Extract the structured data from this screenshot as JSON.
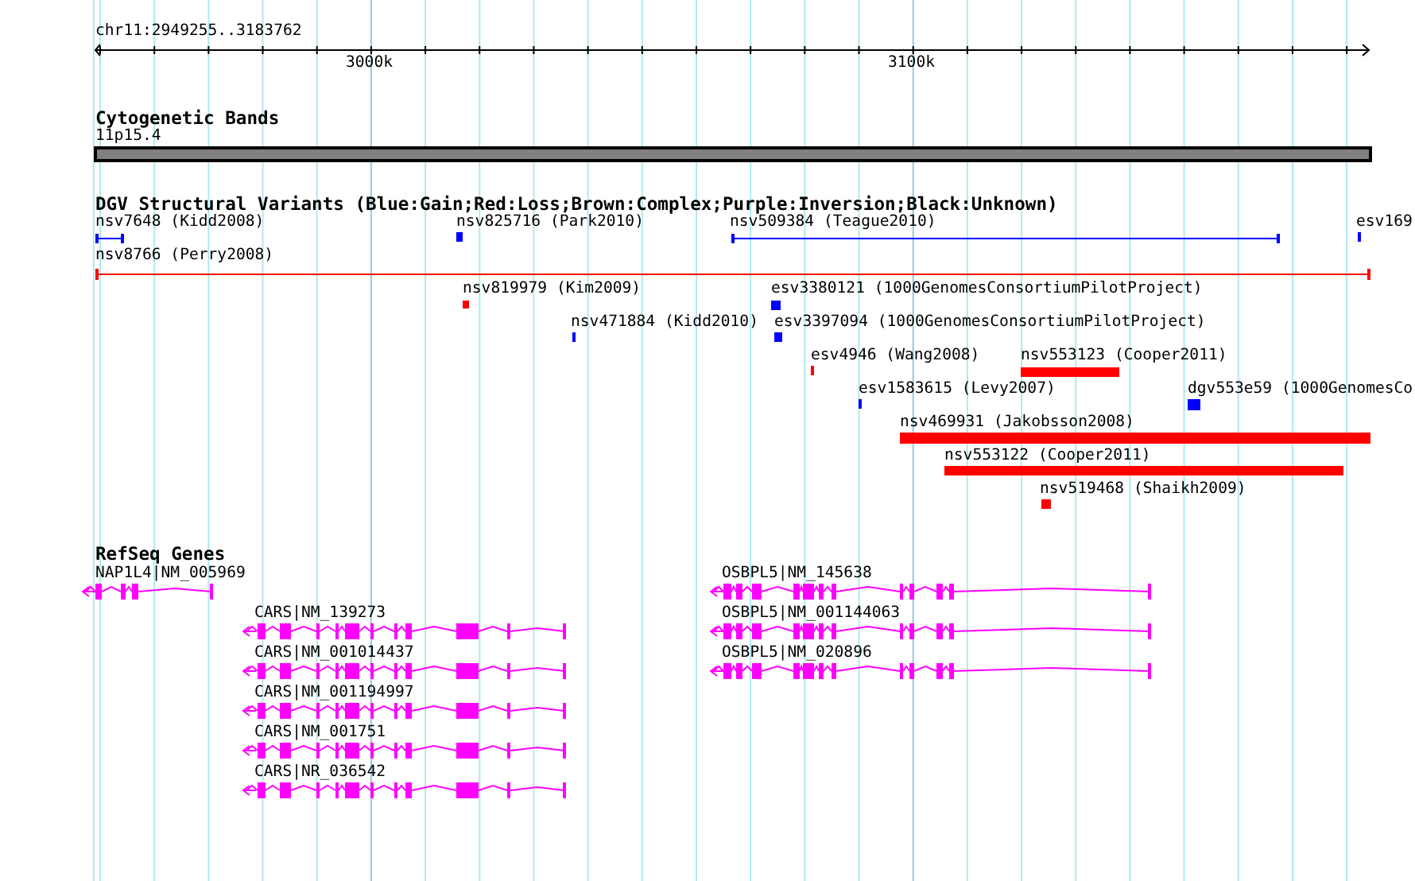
{
  "ruler": {
    "region": "chr11:2949255..3183762",
    "ticks": [
      "3000k",
      "3100k"
    ]
  },
  "tracks": [
    {
      "kind": "cytoband",
      "title": "Cytogenetic Bands",
      "features": [
        {
          "label": "11p15.4"
        }
      ]
    },
    {
      "kind": "variants",
      "title": "DGV Structural Variants (Blue:Gain;Red:Loss;Brown:Complex;Purple:Inversion;Black:Unknown)",
      "features": [
        {
          "label": "nsv7648 (Kidd2008)",
          "color": "#0000ff"
        },
        {
          "label": "nsv825716 (Park2010)",
          "color": "#0000ff"
        },
        {
          "label": "nsv509384 (Teague2010)",
          "color": "#0000ff"
        },
        {
          "label": "esv169",
          "color": "#0000ff"
        },
        {
          "label": "nsv8766 (Perry2008)",
          "color": "#ff0000"
        },
        {
          "label": "nsv819979 (Kim2009)",
          "color": "#ff0000"
        },
        {
          "label": "esv3380121 (1000GenomesConsortiumPilotProject)",
          "color": "#0000ff"
        },
        {
          "label": "nsv471884 (Kidd2010)",
          "color": "#0000ff"
        },
        {
          "label": "esv3397094 (1000GenomesConsortiumPilotProject)",
          "color": "#0000ff"
        },
        {
          "label": "esv4946 (Wang2008)",
          "color": "#ff0000"
        },
        {
          "label": "nsv553123 (Cooper2011)",
          "color": "#ff0000"
        },
        {
          "label": "esv1583615 (Levy2007)",
          "color": "#0000ff"
        },
        {
          "label": "dgv553e59 (1000GenomesCo",
          "color": "#0000ff"
        },
        {
          "label": "nsv469931 (Jakobsson2008)",
          "color": "#ff0000"
        },
        {
          "label": "nsv553122 (Cooper2011)",
          "color": "#ff0000"
        },
        {
          "label": "nsv519468 (Shaikh2009)",
          "color": "#ff0000"
        }
      ]
    },
    {
      "kind": "genes",
      "title": "RefSeq Genes",
      "features": [
        {
          "label": "NAP1L4|NM_005969"
        },
        {
          "label": "CARS|NM_139273"
        },
        {
          "label": "CARS|NM_001014437"
        },
        {
          "label": "CARS|NM_001194997"
        },
        {
          "label": "CARS|NM_001751"
        },
        {
          "label": "CARS|NR_036542"
        },
        {
          "label": "OSBPL5|NM_145638"
        },
        {
          "label": "OSBPL5|NM_001144063"
        },
        {
          "label": "OSBPL5|NM_020896"
        }
      ]
    }
  ]
}
